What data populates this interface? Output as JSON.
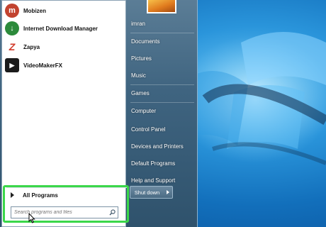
{
  "colors": {
    "highlight": "#3bd74a",
    "start_menu_bg": "#3f6480",
    "left_pane_bg": "#ffffff",
    "desktop_bg": "#1b7fc8"
  },
  "start_menu": {
    "pinned_programs": [
      {
        "label": "Mobizen",
        "icon": "mobizen-icon",
        "icon_color": "#c2432f",
        "glyph": "m"
      },
      {
        "label": "Internet Download Manager",
        "icon": "idm-icon",
        "icon_color": "#2c8a3b",
        "glyph": "↓"
      },
      {
        "label": "Zapya",
        "icon": "zapya-icon",
        "icon_color": "#d23b2b",
        "glyph": "Z"
      },
      {
        "label": "VideoMakerFX",
        "icon": "videomakerfx-icon",
        "icon_color": "#1b1b1b",
        "glyph": "▶"
      }
    ],
    "all_programs_label": "All Programs",
    "search_placeholder": "Search programs and files",
    "right_pane": {
      "user_name": "imran",
      "items": [
        "Documents",
        "Pictures",
        "Music",
        "Games",
        "Computer",
        "Control Panel",
        "Devices and Printers",
        "Default Programs",
        "Help and Support"
      ]
    },
    "shutdown_label": "Shut down"
  }
}
